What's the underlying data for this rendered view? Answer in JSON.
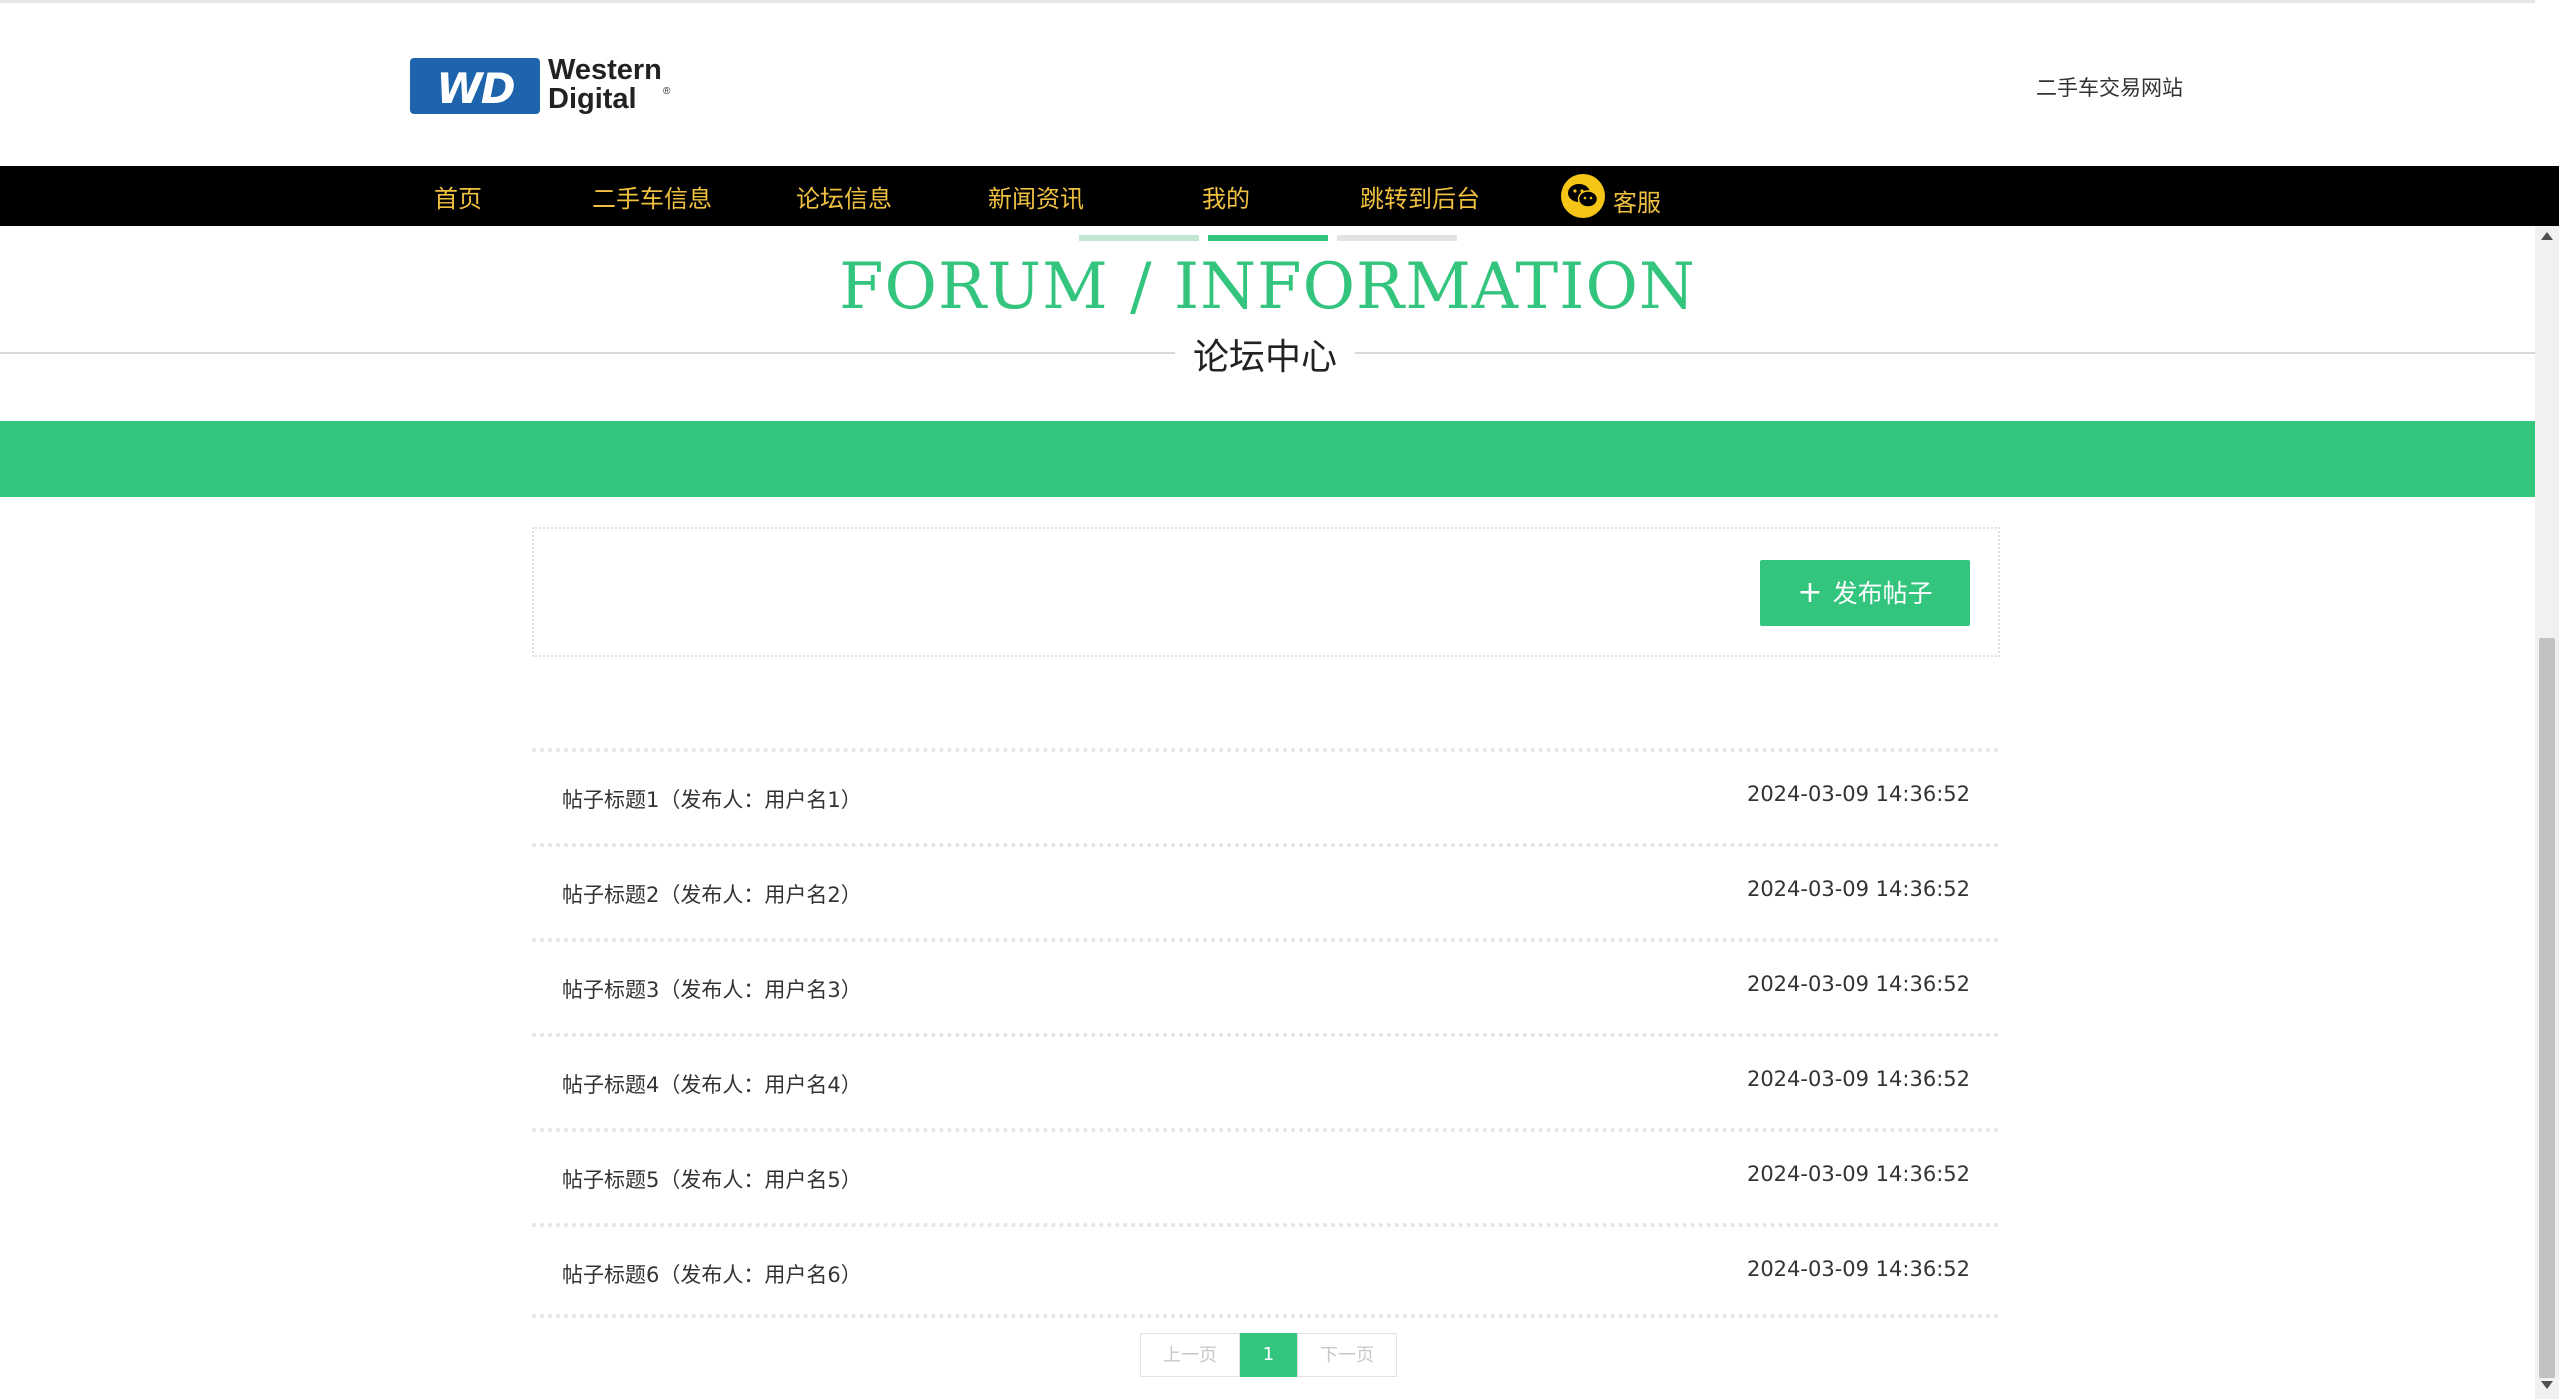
{
  "header": {
    "logo": {
      "mark": "WD",
      "line1": "Western",
      "line2": "Digital",
      "reg": "®"
    },
    "site_name": "二手车交易网站"
  },
  "nav": {
    "items": [
      {
        "label": "首页"
      },
      {
        "label": "二手车信息"
      },
      {
        "label": "论坛信息"
      },
      {
        "label": "新闻资讯"
      },
      {
        "label": "我的"
      },
      {
        "label": "跳转到后台"
      },
      {
        "label": "客服",
        "icon": "wechat-icon"
      }
    ]
  },
  "section": {
    "title": "FORUM / INFORMATION",
    "subtitle": "论坛中心"
  },
  "toolbar": {
    "post_button_icon": "+",
    "post_button_label": "发布帖子"
  },
  "posts": [
    {
      "title": "帖子标题1（发布人：用户名1）",
      "time": "2024-03-09 14:36:52"
    },
    {
      "title": "帖子标题2（发布人：用户名2）",
      "time": "2024-03-09 14:36:52"
    },
    {
      "title": "帖子标题3（发布人：用户名3）",
      "time": "2024-03-09 14:36:52"
    },
    {
      "title": "帖子标题4（发布人：用户名4）",
      "time": "2024-03-09 14:36:52"
    },
    {
      "title": "帖子标题5（发布人：用户名5）",
      "time": "2024-03-09 14:36:52"
    },
    {
      "title": "帖子标题6（发布人：用户名6）",
      "time": "2024-03-09 14:36:52"
    }
  ],
  "pagination": {
    "prev": "上一页",
    "current": "1",
    "next": "下一页"
  },
  "colors": {
    "accent": "#33c47e",
    "nav_text": "#f0c040",
    "nav_bg": "#000000",
    "logo_blue": "#1d64ad"
  }
}
